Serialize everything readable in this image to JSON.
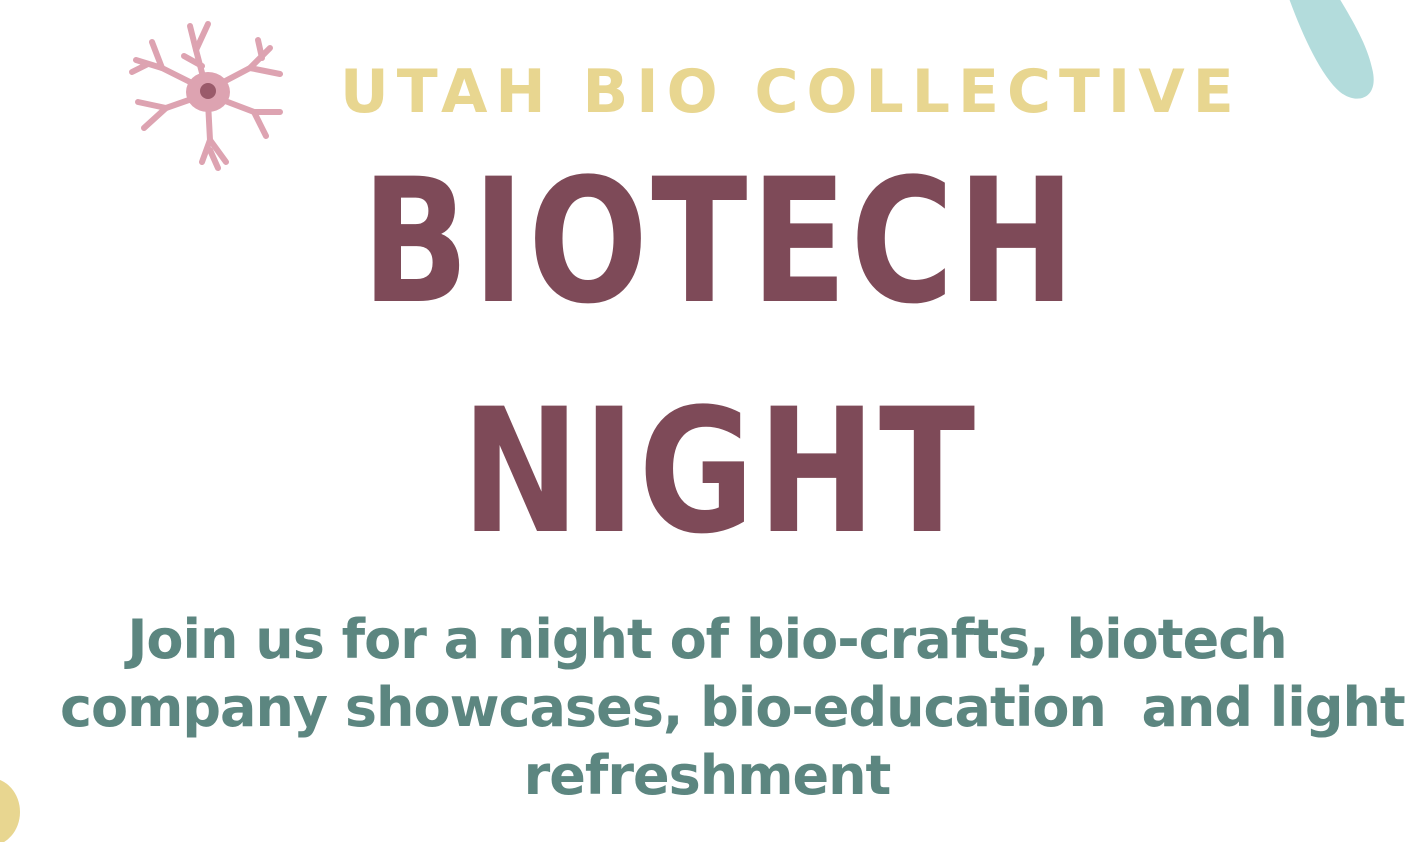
{
  "header": {
    "organization": "UTAH BIO COLLECTIVE"
  },
  "title": {
    "line1": "BIOTECH",
    "line2": "NIGHT"
  },
  "description": {
    "line1": "Join us for a night of bio-crafts, biotech",
    "line2": "company showcases, bio-education  and light",
    "line3": "refreshment"
  },
  "colors": {
    "background": "#ffffff",
    "organization_text": "#e8d690",
    "title_text": "#7e4a58",
    "description_text": "#5c8680",
    "neuron_fill": "#dda3b1",
    "neuron_nucleus": "#9a5a6a",
    "blob_top_right": "#b3dcdc",
    "blob_bottom_left": "#e8d690"
  },
  "decorations": {
    "top_left": "neuron-icon",
    "top_right": "teal-blob",
    "bottom_left": "yellow-blob"
  }
}
